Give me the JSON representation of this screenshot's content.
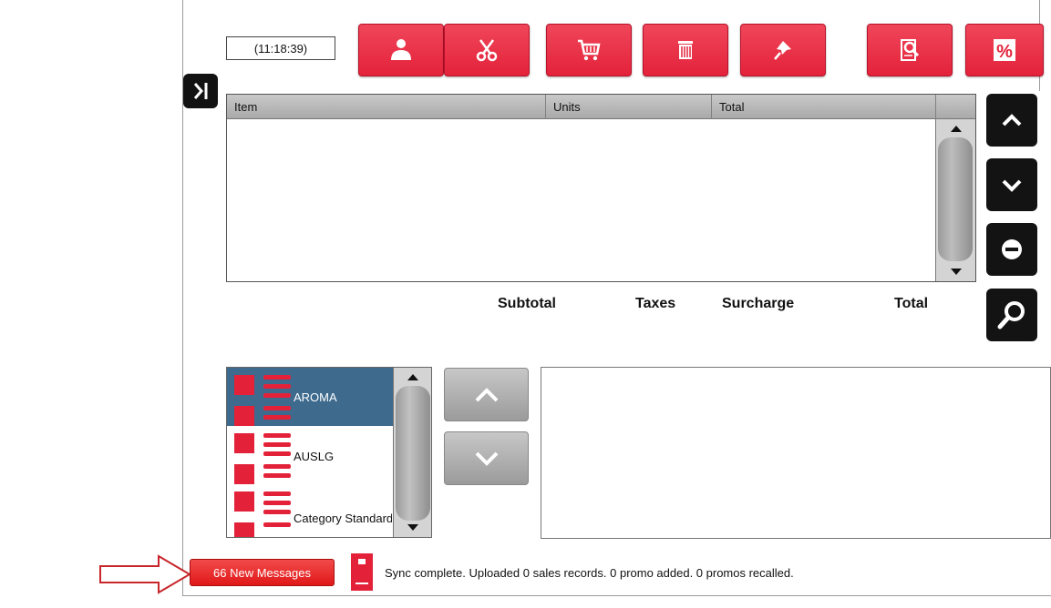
{
  "clock": {
    "time": "(11:18:39)"
  },
  "toolbar": [
    {
      "name": "customer-icon",
      "color": "#e3223a"
    },
    {
      "name": "scissors-icon",
      "color": "#e3223a"
    },
    {
      "name": "cart-icon",
      "color": "#e3223a"
    },
    {
      "name": "trash-icon",
      "color": "#e3223a"
    },
    {
      "name": "pin-icon",
      "color": "#e3223a"
    },
    {
      "name": "receipt-search-icon",
      "color": "#e3223a"
    },
    {
      "name": "percent-icon",
      "color": "#e3223a"
    }
  ],
  "grid": {
    "columns": [
      "Item",
      "Units",
      "Total"
    ],
    "rows": []
  },
  "side_buttons": [
    "chevron-up-icon",
    "chevron-down-icon",
    "minus-circle-icon",
    "search-icon"
  ],
  "totals": {
    "subtotal_label": "Subtotal",
    "taxes_label": "Taxes",
    "surcharge_label": "Surcharge",
    "total_label": "Total"
  },
  "categories": [
    {
      "label": "AROMA",
      "selected": true
    },
    {
      "label": "AUSLG",
      "selected": false
    },
    {
      "label": "Category Standard",
      "selected": false
    }
  ],
  "footer": {
    "messages_button": "66 New Messages",
    "status_text": "Sync complete.  Uploaded 0 sales records. 0 promo added. 0 promos recalled."
  },
  "colors": {
    "accent": "#e3223a",
    "selected_row": "#3d6a8d",
    "dark_button": "#131313",
    "annotation_arrow": "#c8262b"
  }
}
